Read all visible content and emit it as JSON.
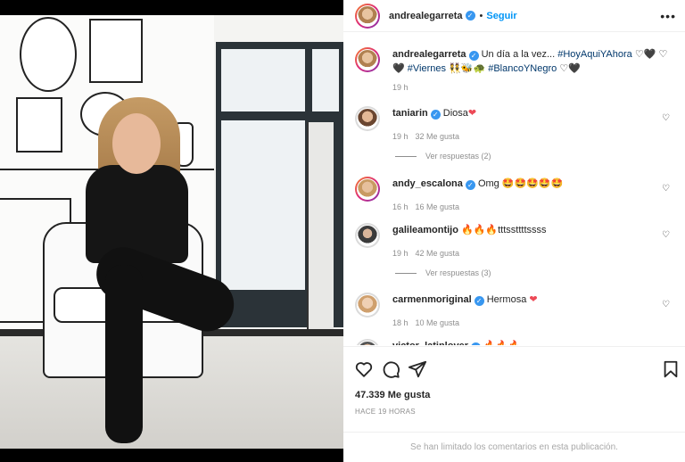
{
  "post": {
    "username": "andrealegarreta",
    "follow_label": "Seguir",
    "separator": "•",
    "caption_text": "Un día a la vez...",
    "caption_tags": [
      "#HoyAquiYAhora",
      "#Viernes",
      "#BlancoYNegro"
    ],
    "caption_emoji_1": "♡🖤",
    "caption_emoji_2": "♡🖤",
    "caption_emoji_3": "👯🐝🐢",
    "caption_emoji_4": "♡🖤",
    "caption_time": "19 h"
  },
  "comments": [
    {
      "user": "taniarin",
      "text": "Diosa",
      "emoji": "❤",
      "time": "19 h",
      "likes": "32 Me gusta",
      "replies": "Ver respuestas (2)"
    },
    {
      "user": "andy_escalona",
      "text": "Omg",
      "emoji": "🤩🤩🤩🤩🤩",
      "time": "16 h",
      "likes": "16 Me gusta",
      "replies": ""
    },
    {
      "user": "galileamontijo",
      "text": "tttssttttssss",
      "emoji": "🔥🔥🔥",
      "time": "19 h",
      "likes": "42 Me gusta",
      "replies": "Ver respuestas (3)"
    },
    {
      "user": "carmenmoriginal",
      "text": "Hermosa",
      "emoji": "❤",
      "time": "18 h",
      "likes": "10 Me gusta",
      "replies": ""
    },
    {
      "user": "victor_latinlover",
      "text": "",
      "emoji": "🔥🔥🔥",
      "time": "",
      "likes": "",
      "replies": ""
    }
  ],
  "footer": {
    "likes": "47.339 Me gusta",
    "time_ago": "HACE 19 HORAS",
    "limited_notice": "Se han limitado los comentarios en esta publicación."
  },
  "icons": {
    "like": "heart-icon",
    "comment": "comment-icon",
    "share": "share-icon",
    "save": "bookmark-icon",
    "more": "more-icon",
    "verified": "verified-badge-icon"
  },
  "colors": {
    "accent": "#0095f6",
    "verified": "#3897f0",
    "muted": "#8e8e8e",
    "heart_red": "#ed4956"
  }
}
